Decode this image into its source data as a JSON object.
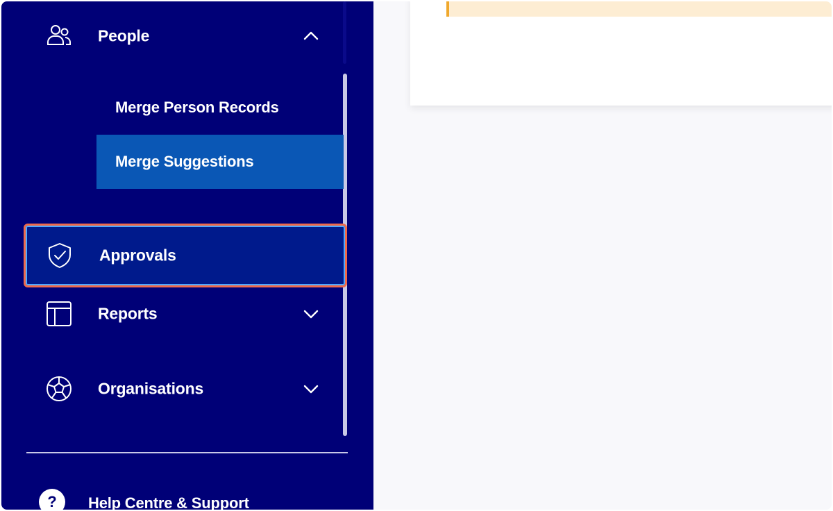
{
  "sidebar": {
    "people": {
      "label": "People",
      "icon": "people-icon",
      "expanded": true
    },
    "people_subitems": [
      {
        "label": "Merge Person Records",
        "active": false
      },
      {
        "label": "Merge Suggestions",
        "active": true
      }
    ],
    "approvals": {
      "label": "Approvals",
      "icon": "shield-check-icon"
    },
    "reports": {
      "label": "Reports",
      "icon": "layout-icon"
    },
    "organisations": {
      "label": "Organisations",
      "icon": "football-icon"
    },
    "help": {
      "label": "Help Centre & Support",
      "icon_glyph": "?"
    }
  },
  "colors": {
    "sidebar_bg": "#000077",
    "active_subitem_bg": "#0a57b5",
    "highlight_border": "#ef6a4a",
    "warning_bg": "#fdedd3",
    "warning_accent": "#f0a82c"
  }
}
